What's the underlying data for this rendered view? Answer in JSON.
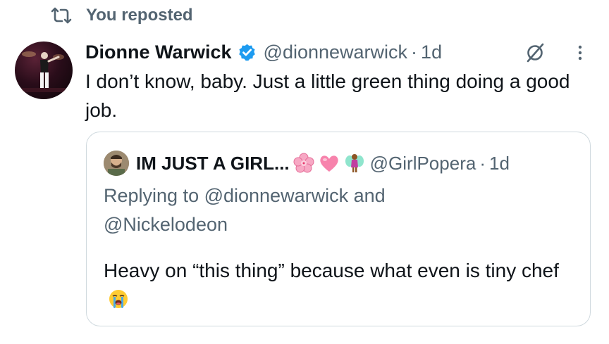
{
  "repost": {
    "icon": "repost-icon",
    "label": "You reposted"
  },
  "post": {
    "author_name": "Dionne Warwick",
    "handle": "@dionnewarwick",
    "separator": "·",
    "time": "1d",
    "verified_icon": "verified-badge-icon",
    "grok_icon": "grok-icon",
    "more_icon": "more-icon",
    "text": "I don’t know, baby. Just a little green thing doing a good job."
  },
  "quote": {
    "author_name": "IM JUST A GIRL...",
    "emojis": [
      "cherry-blossom-emoji",
      "pink-heart-emoji",
      "fairy-emoji"
    ],
    "handle": "@GirlPopera",
    "separator": "·",
    "time": "1d",
    "reply_line1": "Replying to @dionnewarwick and",
    "reply_line2": "@Nickelodeon",
    "text": "Heavy on “this thing” because what even is tiny chef",
    "trailing_emoji": "loudly-crying-face-emoji"
  },
  "colors": {
    "text_primary": "#0f1419",
    "text_secondary": "#536471",
    "verified_blue": "#1d9bf0",
    "border": "#cfd9de"
  }
}
